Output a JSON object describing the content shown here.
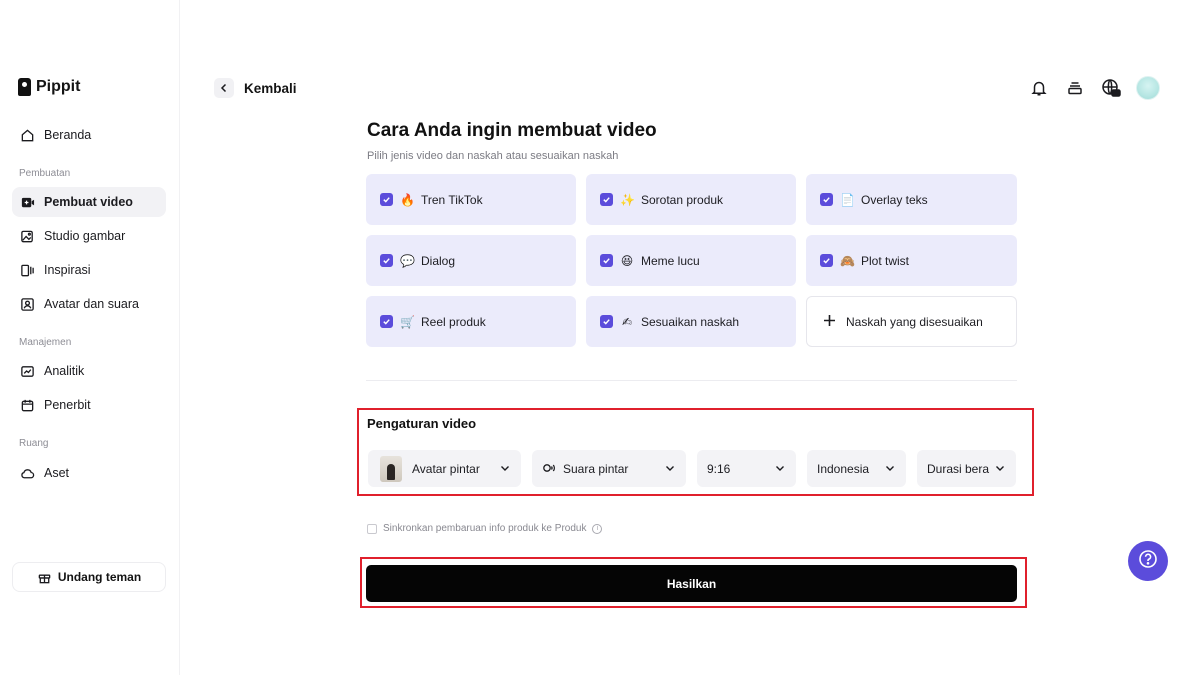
{
  "app": {
    "name": "Pippit"
  },
  "sidebar": {
    "home": {
      "label": "Beranda",
      "icon": "home-icon"
    },
    "sections": [
      {
        "label": "Pembuatan"
      },
      {
        "label": "Manajemen"
      },
      {
        "label": "Ruang"
      }
    ],
    "items": [
      {
        "label": "Pembuat video",
        "icon": "video-create-icon",
        "active": true
      },
      {
        "label": "Studio gambar",
        "icon": "image-studio-icon"
      },
      {
        "label": "Inspirasi",
        "icon": "inspiration-icon"
      },
      {
        "label": "Avatar dan suara",
        "icon": "avatar-voice-icon"
      },
      {
        "label": "Analitik",
        "icon": "analytics-icon"
      },
      {
        "label": "Penerbit",
        "icon": "calendar-icon"
      },
      {
        "label": "Aset",
        "icon": "cloud-icon"
      }
    ],
    "invite_label": "Undang teman"
  },
  "header": {
    "back_label": "Kembali"
  },
  "main": {
    "title": "Cara Anda ingin membuat video",
    "subtitle": "Pilih jenis video dan naskah atau sesuaikan naskah",
    "video_types": [
      {
        "label": "Tren TikTok",
        "emoji": "🔥",
        "checked": true
      },
      {
        "label": "Sorotan produk",
        "emoji": "✨",
        "checked": true
      },
      {
        "label": "Overlay teks",
        "emoji": "📄",
        "checked": true
      },
      {
        "label": "Dialog",
        "emoji": "💬",
        "checked": true
      },
      {
        "label": "Meme lucu",
        "emoji": "😆",
        "checked": true
      },
      {
        "label": "Plot twist",
        "emoji": "🙈",
        "checked": true
      },
      {
        "label": "Reel produk",
        "emoji": "🛒",
        "checked": true
      },
      {
        "label": "Sesuaikan naskah",
        "emoji": "✍",
        "checked": true
      }
    ],
    "custom_script_label": "Naskah yang disesuaikan",
    "settings": {
      "title": "Pengaturan video",
      "avatar": "Avatar pintar",
      "voice": "Suara pintar",
      "ratio": "9:16",
      "language": "Indonesia",
      "duration": "Durasi bera"
    },
    "sync_label": "Sinkronkan pembaruan info produk ke Produk",
    "generate_label": "Hasilkan"
  },
  "colors": {
    "accent": "#5b4cdb",
    "card_bg": "#ebebfb",
    "highlight": "#e0202c",
    "button": "#050505"
  }
}
